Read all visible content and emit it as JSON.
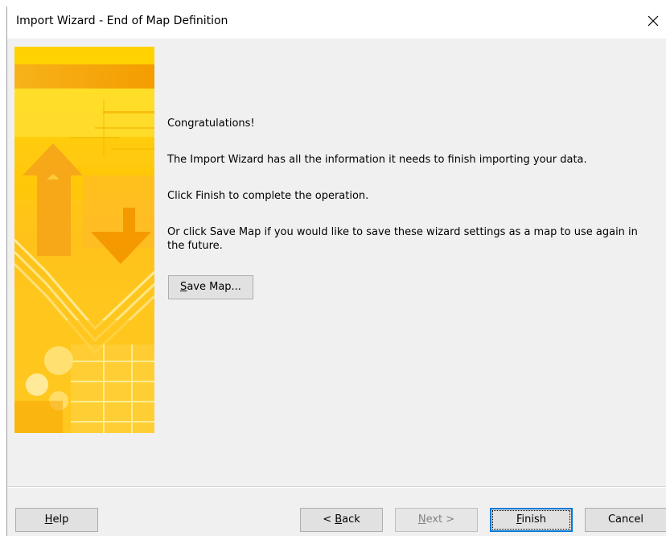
{
  "window": {
    "title": "Import Wizard - End of Map Definition",
    "close_symbol": "✕"
  },
  "icons": {
    "close": "close-icon",
    "art": "wizard-side-artwork"
  },
  "content": {
    "heading": "Congratulations!",
    "info": "The Import Wizard has all the information it needs to finish importing your data.",
    "instruction": "Click Finish to complete the operation.",
    "save_hint": "Or click Save Map if you would like to save these wizard settings as a map to use again in the future."
  },
  "buttons": {
    "save_map": {
      "accel": "S",
      "rest": "ave Map..."
    },
    "help": {
      "accel": "H",
      "rest": "elp"
    },
    "back": {
      "prefix": "< ",
      "accel": "B",
      "rest": "ack"
    },
    "next": {
      "accel": "N",
      "rest": "ext >"
    },
    "finish": {
      "accel": "F",
      "rest": "inish"
    },
    "cancel": "Cancel"
  },
  "colors": {
    "art_yellow": "#ffd400",
    "art_orange": "#f5a300",
    "default_button_border": "#0078d7"
  }
}
